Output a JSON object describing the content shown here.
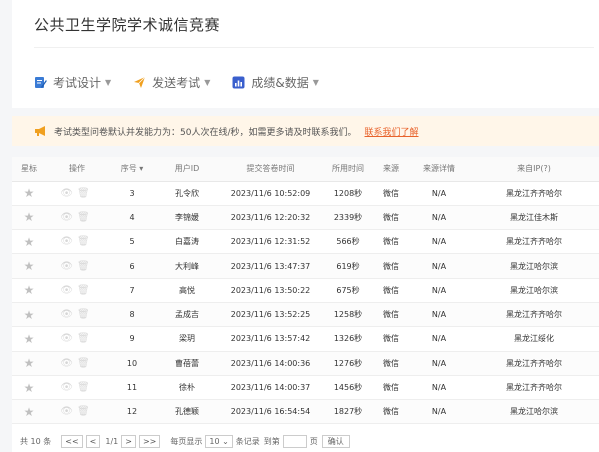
{
  "page_title": "公共卫生学院学术诚信竞赛",
  "toolbar": {
    "items": [
      {
        "label": "考试设计",
        "icon": "exam-design-icon",
        "color": "#3a7bd5"
      },
      {
        "label": "发送考试",
        "icon": "send-icon",
        "color": "#f0a020"
      },
      {
        "label": "成绩&数据",
        "icon": "chart-icon",
        "color": "#3a5fcd"
      }
    ]
  },
  "notice": {
    "text": "考试类型问卷默认并发能力为：50人次在线/秒，如需更多请及时联系我们。",
    "link": "联系我们了解"
  },
  "table": {
    "headers": [
      "星标",
      "操作",
      "序号",
      "用户ID",
      "提交答卷时间",
      "所用时间",
      "来源",
      "来源详情",
      "来自IP(?)"
    ],
    "rows": [
      {
        "seq": "3",
        "user": "孔令欣",
        "time": "2023/11/6 10:52:09",
        "dur": "1208秒",
        "src": "微信",
        "detail": "N/A",
        "ip": "黑龙江齐齐哈尔"
      },
      {
        "seq": "4",
        "user": "李锦媛",
        "time": "2023/11/6 12:20:32",
        "dur": "2339秒",
        "src": "微信",
        "detail": "N/A",
        "ip": "黑龙江佳木斯"
      },
      {
        "seq": "5",
        "user": "白嘉涛",
        "time": "2023/11/6 12:31:52",
        "dur": "566秒",
        "src": "微信",
        "detail": "N/A",
        "ip": "黑龙江齐齐哈尔"
      },
      {
        "seq": "6",
        "user": "大利峰",
        "time": "2023/11/6 13:47:37",
        "dur": "619秒",
        "src": "微信",
        "detail": "N/A",
        "ip": "黑龙江哈尔滨"
      },
      {
        "seq": "7",
        "user": "高悦",
        "time": "2023/11/6 13:50:22",
        "dur": "675秒",
        "src": "微信",
        "detail": "N/A",
        "ip": "黑龙江哈尔滨"
      },
      {
        "seq": "8",
        "user": "孟成吉",
        "time": "2023/11/6 13:52:25",
        "dur": "1258秒",
        "src": "微信",
        "detail": "N/A",
        "ip": "黑龙江齐齐哈尔"
      },
      {
        "seq": "9",
        "user": "梁玥",
        "time": "2023/11/6 13:57:42",
        "dur": "1326秒",
        "src": "微信",
        "detail": "N/A",
        "ip": "黑龙江绥化"
      },
      {
        "seq": "10",
        "user": "曹蓓蕾",
        "time": "2023/11/6 14:00:36",
        "dur": "1276秒",
        "src": "微信",
        "detail": "N/A",
        "ip": "黑龙江齐齐哈尔"
      },
      {
        "seq": "11",
        "user": "徐朴",
        "time": "2023/11/6 14:00:37",
        "dur": "1456秒",
        "src": "微信",
        "detail": "N/A",
        "ip": "黑龙江齐齐哈尔"
      },
      {
        "seq": "12",
        "user": "孔德颖",
        "time": "2023/11/6 16:54:54",
        "dur": "1827秒",
        "src": "微信",
        "detail": "N/A",
        "ip": "黑龙江哈尔滨"
      }
    ]
  },
  "footer": {
    "total": "共 10 条",
    "first": "<<",
    "prev": "<",
    "page_info": "1/1",
    "next": ">",
    "last": ">>",
    "per_page_label": "每页显示",
    "per_page_value": "10",
    "per_page_unit": "条记录",
    "goto_label": "到第",
    "goto_unit": "页",
    "confirm": "确认"
  }
}
